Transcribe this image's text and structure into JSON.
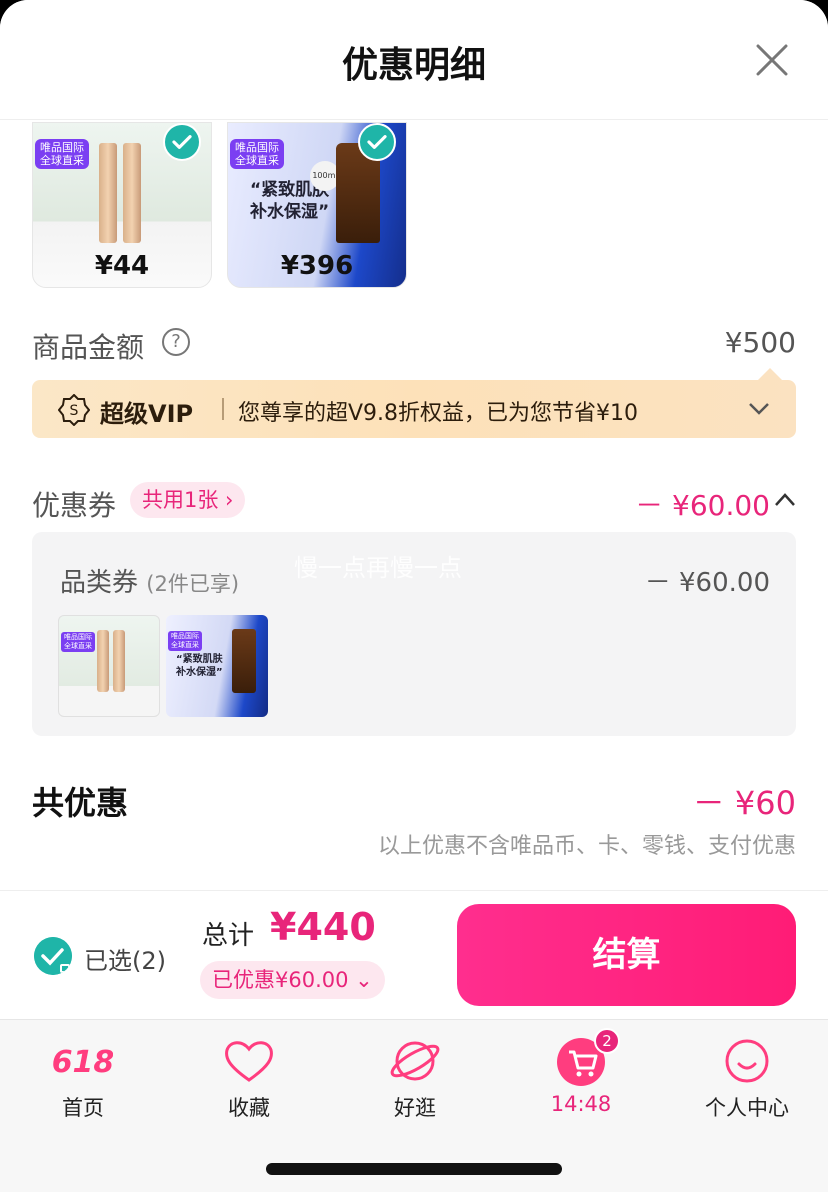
{
  "header": {
    "title": "优惠明细"
  },
  "products": [
    {
      "price": "¥44",
      "tag": "唯品国际\n全球直采"
    },
    {
      "price": "¥396",
      "tag": "唯品国际\n全球直采",
      "promo": "“紧致肌肤\n补水保湿”"
    }
  ],
  "amount": {
    "label": "商品金额",
    "value": "¥500"
  },
  "vip": {
    "name": "超级VIP",
    "text": "您尊享的超V9.8折权益，已为您节省¥10"
  },
  "coupon": {
    "label": "优惠券",
    "pill": "共用1张",
    "value": "－ ¥60.00"
  },
  "category": {
    "label": "品类券",
    "sub": "(2件已享)",
    "value": "－ ¥60.00",
    "watermark": "慢一点再慢一点"
  },
  "total": {
    "label": "共优惠",
    "value": "－ ¥60",
    "note": "以上优惠不含唯品币、卡、零钱、支付优惠"
  },
  "checkout": {
    "selected": "已选(2)",
    "total_label": "总计",
    "total_value": "¥440",
    "saved": "已优惠¥60.00",
    "pay": "结算"
  },
  "tabs": [
    {
      "label": "首页",
      "icon": "618-icon"
    },
    {
      "label": "收藏",
      "icon": "heart-icon"
    },
    {
      "label": "好逛",
      "icon": "planet-icon"
    },
    {
      "label": "14:48",
      "icon": "cart-icon",
      "badge": "2",
      "active": true
    },
    {
      "label": "个人中心",
      "icon": "smile-icon"
    }
  ],
  "colors": {
    "accent": "#e8257a",
    "check": "#1fb5a8",
    "vip_bg": "#fbe2c1"
  }
}
